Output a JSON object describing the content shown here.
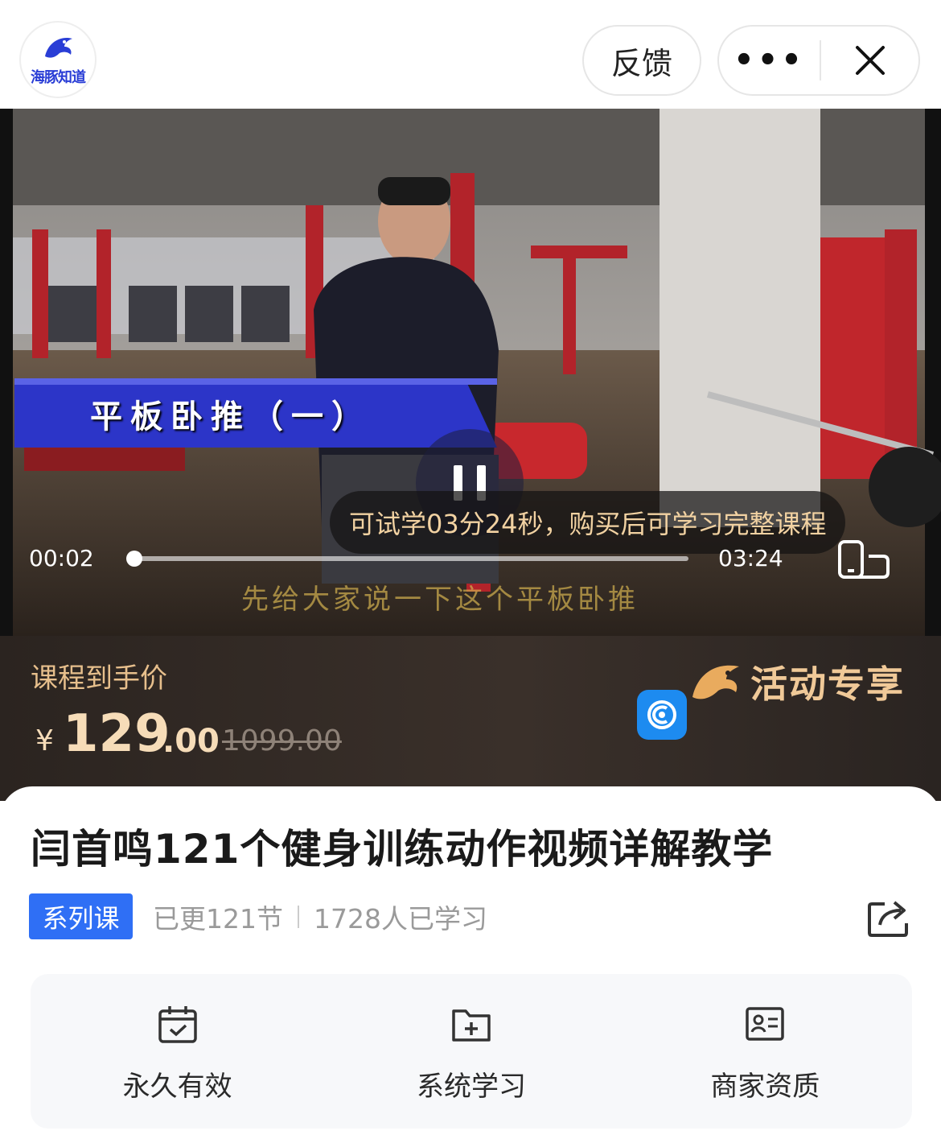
{
  "header": {
    "logo_text": "海豚知道",
    "feedback_label": "反馈",
    "more_label": "•••",
    "close_icon": "close-icon"
  },
  "video": {
    "caption": "平板卧推（一）",
    "subtitle": "先给大家说一下这个平板卧推",
    "trial_note": "可试学03分24秒，购买后可学习完整课程",
    "current_time": "00:02",
    "total_time": "03:24",
    "progress": 0.01,
    "state": "playing"
  },
  "price": {
    "label": "课程到手价",
    "currency": "¥",
    "integer": "129",
    "decimal": ".00",
    "original": "1099.00",
    "promo_text": "活动专享"
  },
  "course": {
    "title": "闫首鸣121个健身训练动作视频详解教学",
    "tag": "系列课",
    "updated": "已更121节",
    "learners": "1728人已学习"
  },
  "features": [
    {
      "icon": "calendar-check-icon",
      "label": "永久有效"
    },
    {
      "icon": "folder-plus-icon",
      "label": "系统学习"
    },
    {
      "icon": "id-card-icon",
      "label": "商家资质"
    }
  ],
  "colors": {
    "tag_blue": "#2f6ff5",
    "price_gold": "#f6dcb8",
    "label_gold": "#e7bf8c",
    "trial_text": "#f2d2a2",
    "caption_blue": "#2c35c8"
  }
}
